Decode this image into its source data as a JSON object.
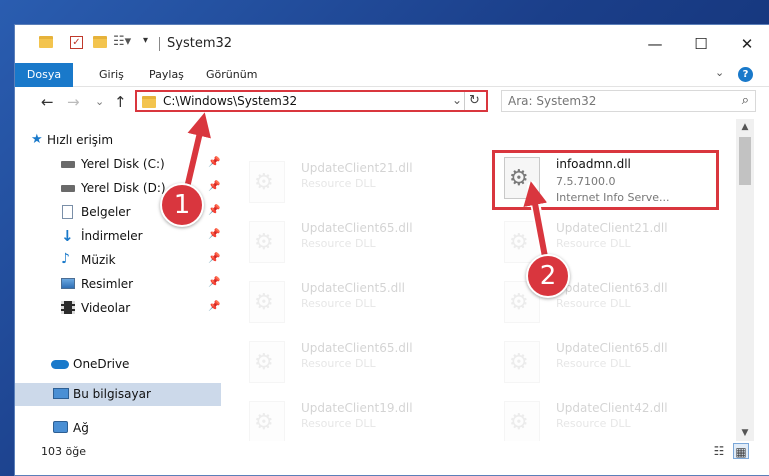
{
  "window": {
    "title": "System32",
    "minimize_glyph": "—",
    "maximize_glyph": "☐",
    "close_glyph": "✕"
  },
  "ribbon": {
    "tabs": [
      "Dosya",
      "Giriş",
      "Paylaş",
      "Görünüm"
    ],
    "help": "?",
    "collapse": "⌄"
  },
  "nav": {
    "back": "←",
    "forward": "→",
    "recent": "⌄",
    "up": "↑",
    "address": "C:\\Windows\\System32",
    "address_dropdown": "⌄",
    "refresh": "↻",
    "search_placeholder": "Ara: System32",
    "search_glyph": "⌕"
  },
  "sidebar": {
    "pin_glyph": "📌",
    "items": [
      {
        "label": "Hızlı erişim",
        "icon": "star-icon",
        "pinned": false
      },
      {
        "label": "Yerel Disk (C:)",
        "icon": "drive-icon",
        "pinned": true
      },
      {
        "label": "Yerel Disk (D:)",
        "icon": "drive-icon",
        "pinned": true
      },
      {
        "label": "Belgeler",
        "icon": "document-icon",
        "pinned": true
      },
      {
        "label": "İndirmeler",
        "icon": "download-icon",
        "pinned": true
      },
      {
        "label": "Müzik",
        "icon": "music-icon",
        "pinned": true
      },
      {
        "label": "Resimler",
        "icon": "pictures-icon",
        "pinned": true
      },
      {
        "label": "Videolar",
        "icon": "video-icon",
        "pinned": true
      },
      {
        "label": "OneDrive",
        "icon": "cloud-icon",
        "pinned": false
      },
      {
        "label": "Bu bilgisayar",
        "icon": "computer-icon",
        "pinned": false,
        "selected": true
      },
      {
        "label": "Ağ",
        "icon": "network-icon",
        "pinned": false
      }
    ]
  },
  "files": {
    "gear_glyph": "⚙",
    "left_column": [
      {
        "name": "UpdateClient21.dll",
        "type": "Resource DLL"
      },
      {
        "name": "UpdateClient65.dll",
        "type": "Resource DLL"
      },
      {
        "name": "UpdateClient5.dll",
        "type": "Resource DLL"
      },
      {
        "name": "UpdateClient65.dll",
        "type": "Resource DLL"
      },
      {
        "name": "UpdateClient19.dll",
        "type": "Resource DLL"
      }
    ],
    "right_column": [
      {
        "name": "UpdateClient21.dll",
        "type": "Resource DLL"
      },
      {
        "name": "UpdateClient63.dll",
        "type": "Resource DLL"
      },
      {
        "name": "UpdateClient65.dll",
        "type": "Resource DLL"
      },
      {
        "name": "UpdateClient42.dll",
        "type": "Resource DLL"
      }
    ],
    "highlighted": {
      "name": "infoadmn.dll",
      "version": "7.5.7100.0",
      "description": "Internet Info Serve..."
    }
  },
  "scrollbar": {
    "up": "▲",
    "down": "▼"
  },
  "status": {
    "item_count": "103 öğe",
    "details_view_glyph": "☷",
    "tiles_view_glyph": "▦"
  },
  "annotations": [
    {
      "number": "1",
      "color": "#d9363e"
    },
    {
      "number": "2",
      "color": "#d9363e"
    }
  ],
  "colors": {
    "accent": "#1979ca",
    "highlight": "#d9363e",
    "selection": "#ccd9ea"
  }
}
